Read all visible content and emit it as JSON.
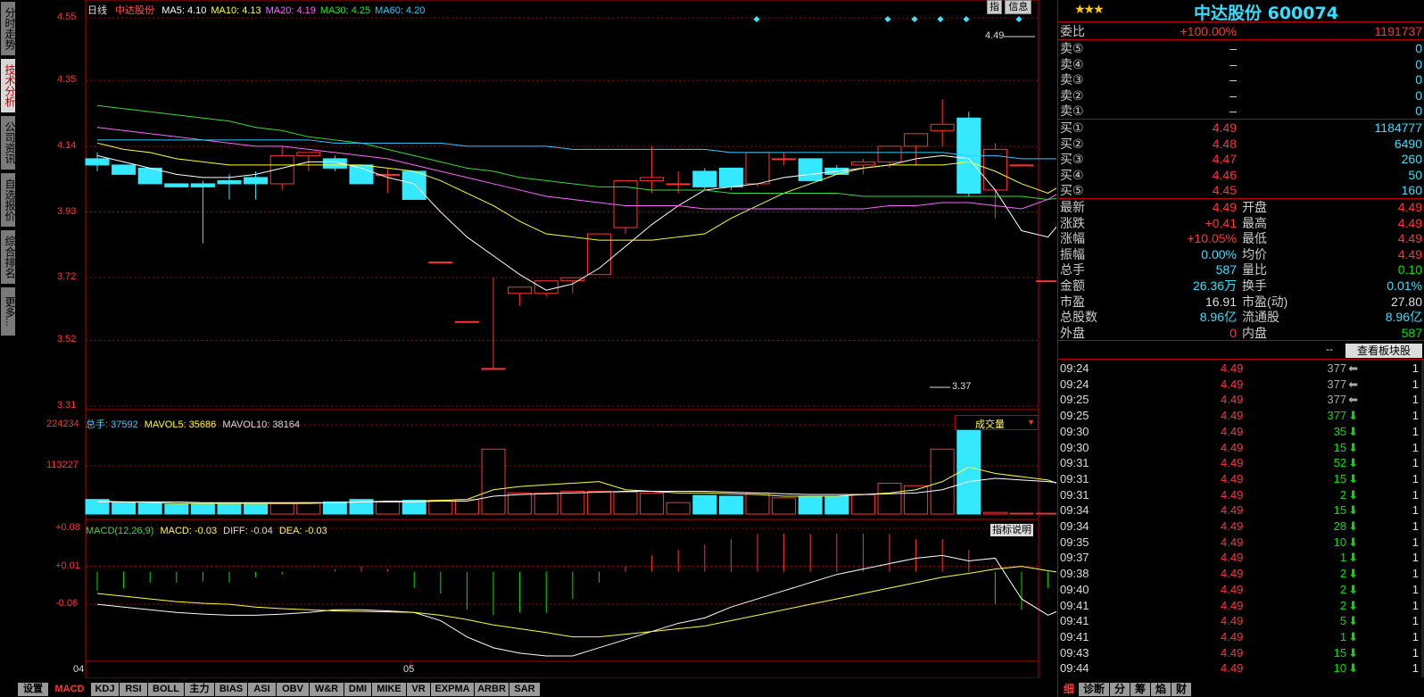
{
  "left_nav": [
    "分时走势",
    "技术分析",
    "公司资讯",
    "自选报价",
    "综合排名",
    "更多..."
  ],
  "left_nav_active": 1,
  "main": {
    "period": "日线",
    "stock_name": "中达股份",
    "ma": [
      {
        "label": "MA5: 4.10",
        "color": "#ffffff"
      },
      {
        "label": "MA10: 4.13",
        "color": "#ffff33"
      },
      {
        "label": "MA20: 4.19",
        "color": "#ff66ff"
      },
      {
        "label": "MA30: 4.25",
        "color": "#33dd33"
      },
      {
        "label": "MA60: 4.20",
        "color": "#33ccff"
      }
    ],
    "yticks": [
      "4.55",
      "4.35",
      "4.14",
      "3.93",
      "3.72",
      "3.52",
      "3.31"
    ],
    "hi_label": "4.49",
    "lo_label": "3.37",
    "buttons": [
      "指",
      "信息"
    ],
    "date_labels": [
      "04",
      "05"
    ]
  },
  "volume": {
    "title": "总手: 37592",
    "mavol5": "MAVOL5: 35686",
    "mavol10": "MAVOL10: 38164",
    "yticks": [
      "224234",
      "113227"
    ],
    "selector": "成交量"
  },
  "macd": {
    "title": "MACD(12,26,9)",
    "macd": "MACD: -0.03",
    "diff": "DIFF: -0.04",
    "dea": "DEA: -0.03",
    "yticks": [
      "+0.08",
      "+0.01",
      "-0.06"
    ],
    "help": "指标说明"
  },
  "bottom_tabs": [
    "设置",
    "MACD",
    "KDJ",
    "RSI",
    "BOLL",
    "主力",
    "BIAS",
    "ASI",
    "OBV",
    "W&R",
    "DMI",
    "MIKE",
    "VR",
    "EXPMA",
    "ARBR",
    "SAR"
  ],
  "bottom_active": 1,
  "quote": {
    "stars": "★★★",
    "title": "中达股份 600074",
    "weibi": {
      "label": "委比",
      "pct": "+100.00%",
      "val": "1191737"
    },
    "sells": [
      {
        "label": "卖⑤",
        "price": "–",
        "vol": "0"
      },
      {
        "label": "卖④",
        "price": "–",
        "vol": "0"
      },
      {
        "label": "卖③",
        "price": "–",
        "vol": "0"
      },
      {
        "label": "卖②",
        "price": "–",
        "vol": "0"
      },
      {
        "label": "卖①",
        "price": "–",
        "vol": "0"
      }
    ],
    "buys": [
      {
        "label": "买①",
        "price": "4.49",
        "vol": "1184777"
      },
      {
        "label": "买②",
        "price": "4.48",
        "vol": "6490"
      },
      {
        "label": "买③",
        "price": "4.47",
        "vol": "260"
      },
      {
        "label": "买④",
        "price": "4.46",
        "vol": "50"
      },
      {
        "label": "买⑤",
        "price": "4.45",
        "vol": "160"
      }
    ],
    "stats": [
      {
        "l1": "最新",
        "v1": "4.49",
        "c1": "red",
        "l2": "开盘",
        "v2": "4.49",
        "c2": "red"
      },
      {
        "l1": "涨跌",
        "v1": "+0.41",
        "c1": "red",
        "l2": "最高",
        "v2": "4.49",
        "c2": "red"
      },
      {
        "l1": "涨幅",
        "v1": "+10.05%",
        "c1": "red",
        "l2": "最低",
        "v2": "4.49",
        "c2": "red"
      },
      {
        "l1": "振幅",
        "v1": "0.00%",
        "c1": "cyan",
        "l2": "均价",
        "v2": "4.49",
        "c2": "red"
      },
      {
        "l1": "总手",
        "v1": "587",
        "c1": "cyan",
        "l2": "量比",
        "v2": "0.10",
        "c2": "grn"
      },
      {
        "l1": "金额",
        "v1": "26.36万",
        "c1": "cyan",
        "l2": "换手",
        "v2": "0.01%",
        "c2": "cyan"
      },
      {
        "l1": "市盈",
        "v1": "16.91",
        "c1": "wht",
        "l2": "市盈(动)",
        "v2": "27.80",
        "c2": "wht"
      },
      {
        "l1": "总股数",
        "v1": "8.96亿",
        "c1": "cyan",
        "l2": "流通股",
        "v2": "8.96亿",
        "c2": "cyan"
      },
      {
        "l1": "外盘",
        "v1": "0",
        "c1": "red",
        "l2": "内盘",
        "v2": "587",
        "c2": "grn"
      }
    ],
    "block_dash": "--",
    "block_button": "查看板块股"
  },
  "ticks": [
    {
      "t": "09:24",
      "p": "4.49",
      "v": "377",
      "d": "gray",
      "c": "1"
    },
    {
      "t": "09:24",
      "p": "4.49",
      "v": "377",
      "d": "gray",
      "c": "1"
    },
    {
      "t": "09:25",
      "p": "4.49",
      "v": "377",
      "d": "gray",
      "c": "1"
    },
    {
      "t": "09:25",
      "p": "4.49",
      "v": "377",
      "d": "down",
      "c": "1"
    },
    {
      "t": "09:30",
      "p": "4.49",
      "v": "35",
      "d": "down",
      "c": "1"
    },
    {
      "t": "09:30",
      "p": "4.49",
      "v": "15",
      "d": "down",
      "c": "1"
    },
    {
      "t": "09:31",
      "p": "4.49",
      "v": "52",
      "d": "down",
      "c": "1"
    },
    {
      "t": "09:31",
      "p": "4.49",
      "v": "15",
      "d": "down",
      "c": "1"
    },
    {
      "t": "09:31",
      "p": "4.49",
      "v": "2",
      "d": "down",
      "c": "1"
    },
    {
      "t": "09:34",
      "p": "4.49",
      "v": "15",
      "d": "down",
      "c": "1"
    },
    {
      "t": "09:34",
      "p": "4.49",
      "v": "28",
      "d": "down",
      "c": "1"
    },
    {
      "t": "09:35",
      "p": "4.49",
      "v": "10",
      "d": "down",
      "c": "1"
    },
    {
      "t": "09:37",
      "p": "4.49",
      "v": "1",
      "d": "down",
      "c": "1"
    },
    {
      "t": "09:38",
      "p": "4.49",
      "v": "2",
      "d": "down",
      "c": "1"
    },
    {
      "t": "09:40",
      "p": "4.49",
      "v": "2",
      "d": "down",
      "c": "1"
    },
    {
      "t": "09:41",
      "p": "4.49",
      "v": "2",
      "d": "down",
      "c": "1"
    },
    {
      "t": "09:41",
      "p": "4.49",
      "v": "5",
      "d": "down",
      "c": "1"
    },
    {
      "t": "09:41",
      "p": "4.49",
      "v": "1",
      "d": "down",
      "c": "1"
    },
    {
      "t": "09:43",
      "p": "4.49",
      "v": "15",
      "d": "down",
      "c": "1"
    },
    {
      "t": "09:44",
      "p": "4.49",
      "v": "10",
      "d": "down",
      "c": "1"
    }
  ],
  "right_tabs": [
    "细",
    "诊断",
    "分",
    "筹",
    "焰",
    "财"
  ],
  "right_active": 0,
  "candles": [
    [
      4.1,
      4.12,
      4.08,
      4.06
    ],
    [
      4.08,
      4.08,
      4.05,
      4.07
    ],
    [
      4.07,
      4.05,
      4.02,
      4.08
    ],
    [
      4.02,
      4.02,
      4.01,
      4.07
    ],
    [
      4.02,
      4.03,
      4.01,
      3.83
    ],
    [
      4.03,
      4.05,
      4.02,
      3.97
    ],
    [
      4.04,
      4.06,
      4.02,
      3.97
    ],
    [
      4.02,
      4.14,
      4.11,
      4.0
    ],
    [
      4.11,
      4.1,
      4.12,
      4.06
    ],
    [
      4.1,
      4.11,
      4.07,
      4.06
    ],
    [
      4.08,
      4.06,
      4.02,
      4.03
    ],
    [
      4.05,
      4.07,
      4.05,
      3.99
    ],
    [
      4.06,
      4.04,
      3.97,
      3.97
    ],
    [
      3.77,
      3.77,
      3.77,
      3.77
    ],
    [
      3.58,
      3.58,
      3.58,
      3.58
    ],
    [
      3.43,
      3.72,
      3.43,
      3.76
    ],
    [
      3.67,
      3.67,
      3.69,
      3.63
    ],
    [
      3.67,
      3.68,
      3.71,
      3.66
    ],
    [
      3.71,
      3.68,
      3.72,
      3.67
    ],
    [
      3.73,
      3.73,
      3.86,
      3.88
    ],
    [
      3.88,
      3.88,
      4.03,
      3.86
    ],
    [
      4.03,
      4.14,
      4.04,
      3.99
    ],
    [
      4.02,
      4.06,
      4.02,
      3.99
    ],
    [
      4.06,
      4.07,
      4.01,
      4.0
    ],
    [
      4.07,
      4.06,
      4.01,
      4.0
    ],
    [
      4.02,
      4.08,
      4.12,
      4.01
    ],
    [
      4.1,
      4.12,
      4.1,
      4.08
    ],
    [
      4.1,
      4.1,
      4.03,
      4.04
    ],
    [
      4.07,
      4.08,
      4.05,
      4.06
    ],
    [
      4.08,
      4.1,
      4.09,
      4.05
    ],
    [
      4.09,
      4.1,
      4.14,
      4.07
    ],
    [
      4.14,
      4.17,
      4.18,
      4.08
    ],
    [
      4.19,
      4.29,
      4.21,
      4.14
    ],
    [
      4.23,
      4.25,
      3.99,
      3.98
    ],
    [
      4.0,
      4.15,
      4.13,
      3.91
    ],
    [
      4.08,
      4.08,
      4.08,
      4.08
    ],
    [
      3.71,
      3.71,
      3.71,
      3.71
    ]
  ],
  "vols": [
    18,
    14,
    13,
    12,
    12,
    12,
    12,
    13,
    14,
    15,
    18,
    15,
    17,
    17,
    18,
    80,
    26,
    26,
    28,
    28,
    27,
    26,
    14,
    23,
    22,
    26,
    20,
    22,
    22,
    24,
    38,
    35,
    80,
    105,
    2,
    1,
    1
  ],
  "macd_bars": [
    -0.035,
    -0.03,
    -0.02,
    -0.02,
    -0.018,
    -0.02,
    -0.01,
    -0.005,
    0,
    0.005,
    0.01,
    0.005,
    -0.03,
    -0.04,
    -0.07,
    -0.08,
    -0.075,
    -0.075,
    -0.05,
    -0.02,
    0.01,
    0.03,
    0.04,
    0.05,
    0.06,
    0.07,
    0.07,
    0.07,
    0.07,
    0.07,
    0.07,
    0.06,
    0.06,
    0.04,
    -0.06,
    -0.07,
    -0.03,
    0.02
  ],
  "ma_lines": {
    "ma5": [
      4.11,
      4.09,
      4.07,
      4.05,
      4.04,
      4.04,
      4.05,
      4.07,
      4.09,
      4.09,
      4.07,
      4.04,
      4.02,
      3.93,
      3.85,
      3.79,
      3.73,
      3.68,
      3.7,
      3.75,
      3.82,
      3.89,
      3.95,
      4.0,
      4.01,
      4.02,
      4.04,
      4.05,
      4.06,
      4.07,
      4.08,
      4.1,
      4.11,
      4.1,
      4.0,
      3.87,
      3.85,
      3.95
    ],
    "ma10": [
      4.15,
      4.13,
      4.12,
      4.1,
      4.09,
      4.08,
      4.08,
      4.08,
      4.08,
      4.08,
      4.08,
      4.07,
      4.06,
      4.03,
      3.99,
      3.95,
      3.9,
      3.86,
      3.85,
      3.84,
      3.84,
      3.84,
      3.85,
      3.86,
      3.91,
      3.95,
      3.99,
      4.02,
      4.05,
      4.07,
      4.08,
      4.08,
      4.08,
      4.09,
      4.06,
      4.02,
      3.99,
      4.04
    ],
    "ma20": [
      4.2,
      4.19,
      4.18,
      4.17,
      4.16,
      4.15,
      4.14,
      4.14,
      4.13,
      4.12,
      4.11,
      4.1,
      4.08,
      4.06,
      4.04,
      4.02,
      4.0,
      3.98,
      3.97,
      3.96,
      3.95,
      3.95,
      3.95,
      3.94,
      3.94,
      3.94,
      3.94,
      3.94,
      3.94,
      3.94,
      3.95,
      3.95,
      3.96,
      3.96,
      3.95,
      3.94,
      3.97,
      4.02
    ],
    "ma30": [
      4.27,
      4.26,
      4.25,
      4.24,
      4.23,
      4.22,
      4.2,
      4.19,
      4.17,
      4.16,
      4.15,
      4.13,
      4.11,
      4.09,
      4.07,
      4.06,
      4.04,
      4.03,
      4.02,
      4.01,
      4.01,
      4.0,
      4.0,
      4.0,
      3.99,
      3.99,
      3.99,
      3.99,
      3.99,
      3.98,
      3.98,
      3.98,
      3.98,
      3.98,
      3.98,
      3.98,
      3.97,
      3.98
    ],
    "ma60": [
      4.16,
      4.16,
      4.16,
      4.16,
      4.16,
      4.16,
      4.16,
      4.16,
      4.16,
      4.15,
      4.15,
      4.15,
      4.15,
      4.15,
      4.14,
      4.14,
      4.14,
      4.14,
      4.13,
      4.13,
      4.13,
      4.13,
      4.13,
      4.13,
      4.12,
      4.12,
      4.12,
      4.12,
      4.12,
      4.12,
      4.12,
      4.12,
      4.12,
      4.11,
      4.11,
      4.1,
      4.1,
      4.1
    ]
  },
  "vol_ma": {
    "mv5": [
      16,
      15,
      14,
      13,
      13,
      13,
      13,
      13,
      13,
      14,
      15,
      16,
      16,
      17,
      18,
      30,
      34,
      36,
      38,
      40,
      30,
      28,
      26,
      26,
      25,
      24,
      22,
      22,
      22,
      24,
      26,
      30,
      40,
      58,
      50,
      46,
      42,
      30
    ],
    "mv10": [
      15,
      15,
      15,
      15,
      14,
      14,
      14,
      14,
      14,
      14,
      15,
      15,
      15,
      16,
      16,
      22,
      24,
      25,
      26,
      27,
      28,
      28,
      28,
      28,
      27,
      26,
      25,
      24,
      24,
      24,
      25,
      26,
      30,
      40,
      44,
      42,
      40,
      36
    ]
  },
  "macd_lines": {
    "diff": [
      -0.06,
      -0.065,
      -0.07,
      -0.075,
      -0.078,
      -0.08,
      -0.08,
      -0.078,
      -0.075,
      -0.07,
      -0.07,
      -0.072,
      -0.075,
      -0.09,
      -0.12,
      -0.14,
      -0.15,
      -0.155,
      -0.155,
      -0.14,
      -0.125,
      -0.11,
      -0.095,
      -0.085,
      -0.065,
      -0.05,
      -0.035,
      -0.02,
      -0.005,
      0.005,
      0.015,
      0.025,
      0.03,
      0.02,
      0.025,
      -0.05,
      -0.08,
      -0.06,
      -0.01
    ],
    "dea": [
      -0.04,
      -0.045,
      -0.05,
      -0.055,
      -0.058,
      -0.06,
      -0.065,
      -0.068,
      -0.07,
      -0.072,
      -0.073,
      -0.074,
      -0.075,
      -0.08,
      -0.088,
      -0.098,
      -0.105,
      -0.112,
      -0.12,
      -0.12,
      -0.115,
      -0.11,
      -0.105,
      -0.1,
      -0.09,
      -0.08,
      -0.07,
      -0.06,
      -0.05,
      -0.04,
      -0.03,
      -0.02,
      -0.01,
      -0.003,
      0.005,
      0.01,
      0.002,
      -0.005,
      -0.02
    ]
  }
}
